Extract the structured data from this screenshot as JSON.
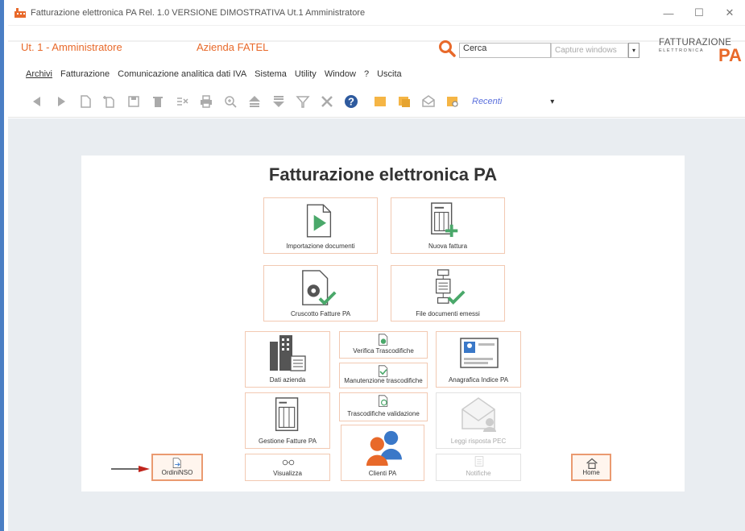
{
  "window": {
    "title": "Fatturazione elettronica PA Rel. 1.0 VERSIONE DIMOSTRATIVA Ut.1 Amministratore",
    "minimize": "—",
    "maximize": "☐",
    "close": "✕"
  },
  "header": {
    "user": "Ut. 1 - Amministratore",
    "company": "Azienda FATEL",
    "search_value": "Cerca",
    "capture_placeholder": "Capture windows",
    "brand_line1": "FATTURAZIONE",
    "brand_line2": "ELETTRONICA",
    "brand_pa": "PA"
  },
  "menu": [
    {
      "label": "Archivi",
      "key": "A"
    },
    {
      "label": "Fatturazione",
      "key": "F"
    },
    {
      "label": "Comunicazione analitica dati IVA",
      "key": ""
    },
    {
      "label": "Sistema",
      "key": "S"
    },
    {
      "label": "Utility",
      "key": "U"
    },
    {
      "label": "Window",
      "key": "W"
    },
    {
      "label": "?",
      "key": "?"
    },
    {
      "label": "Uscita",
      "key": ""
    }
  ],
  "toolbar": {
    "recenti": "Recenti",
    "recenti_drop": "▾"
  },
  "panel": {
    "title": "Fatturazione elettronica PA"
  },
  "tiles": {
    "importazione": "Importazione documenti",
    "nuova_fattura": "Nuova fattura",
    "cruscotto": "Cruscotto Fatture PA",
    "file_emessi": "File documenti emessi",
    "dati_azienda": "Dati azienda",
    "verifica": "Verifica Trascodifiche",
    "manutenzione": "Manutenzione trascodifiche",
    "trascodifiche_validazione": "Trascodifiche validazione",
    "anagrafica": "Anagrafica Indice PA",
    "gestione": "Gestione Fatture PA",
    "leggi_pec": "Leggi risposta PEC",
    "clienti": "Clienti PA",
    "visualizza": "Visualizza",
    "notifiche": "Notifiche",
    "ordini": "OrdiniNSO",
    "home": "Home"
  },
  "colors": {
    "accent": "#e8692a",
    "tile_border": "#f2c9b2",
    "green": "#4aa86a",
    "frame_blue": "#4a7ec4"
  }
}
